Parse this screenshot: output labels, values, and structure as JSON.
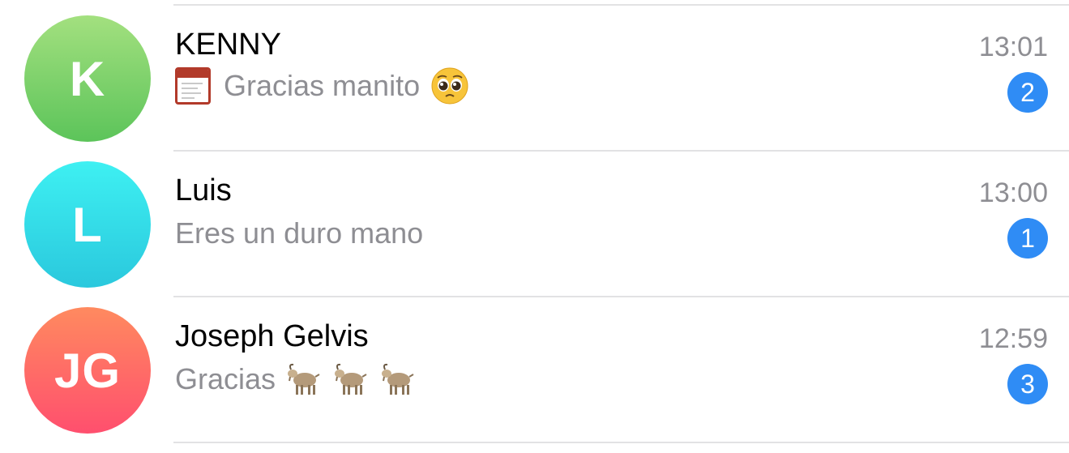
{
  "chats": [
    {
      "initials": "K",
      "name": "KENNY",
      "preview": "Gracias manito",
      "time": "13:01",
      "unread": "2",
      "avatar_gradient": [
        "#a3e07f",
        "#5cc45a"
      ],
      "preview_icons": [
        "photo-thumbnail-icon",
        "pleading-face-emoji"
      ]
    },
    {
      "initials": "L",
      "name": "Luis",
      "preview": "Eres un duro mano",
      "time": "13:00",
      "unread": "1",
      "avatar_gradient": [
        "#3ef0f2",
        "#2ac8dd"
      ],
      "preview_icons": []
    },
    {
      "initials": "JG",
      "name": "Joseph Gelvis",
      "preview": "Gracias",
      "time": "12:59",
      "unread": "3",
      "avatar_gradient": [
        "#ff8a5f",
        "#ff4f6e"
      ],
      "preview_icons": [
        "goat-emoji",
        "goat-emoji",
        "goat-emoji"
      ]
    }
  ],
  "colors": {
    "badge": "#2f8cf5",
    "secondary_text": "#8e8e93",
    "separator": "#e2e2e4"
  }
}
